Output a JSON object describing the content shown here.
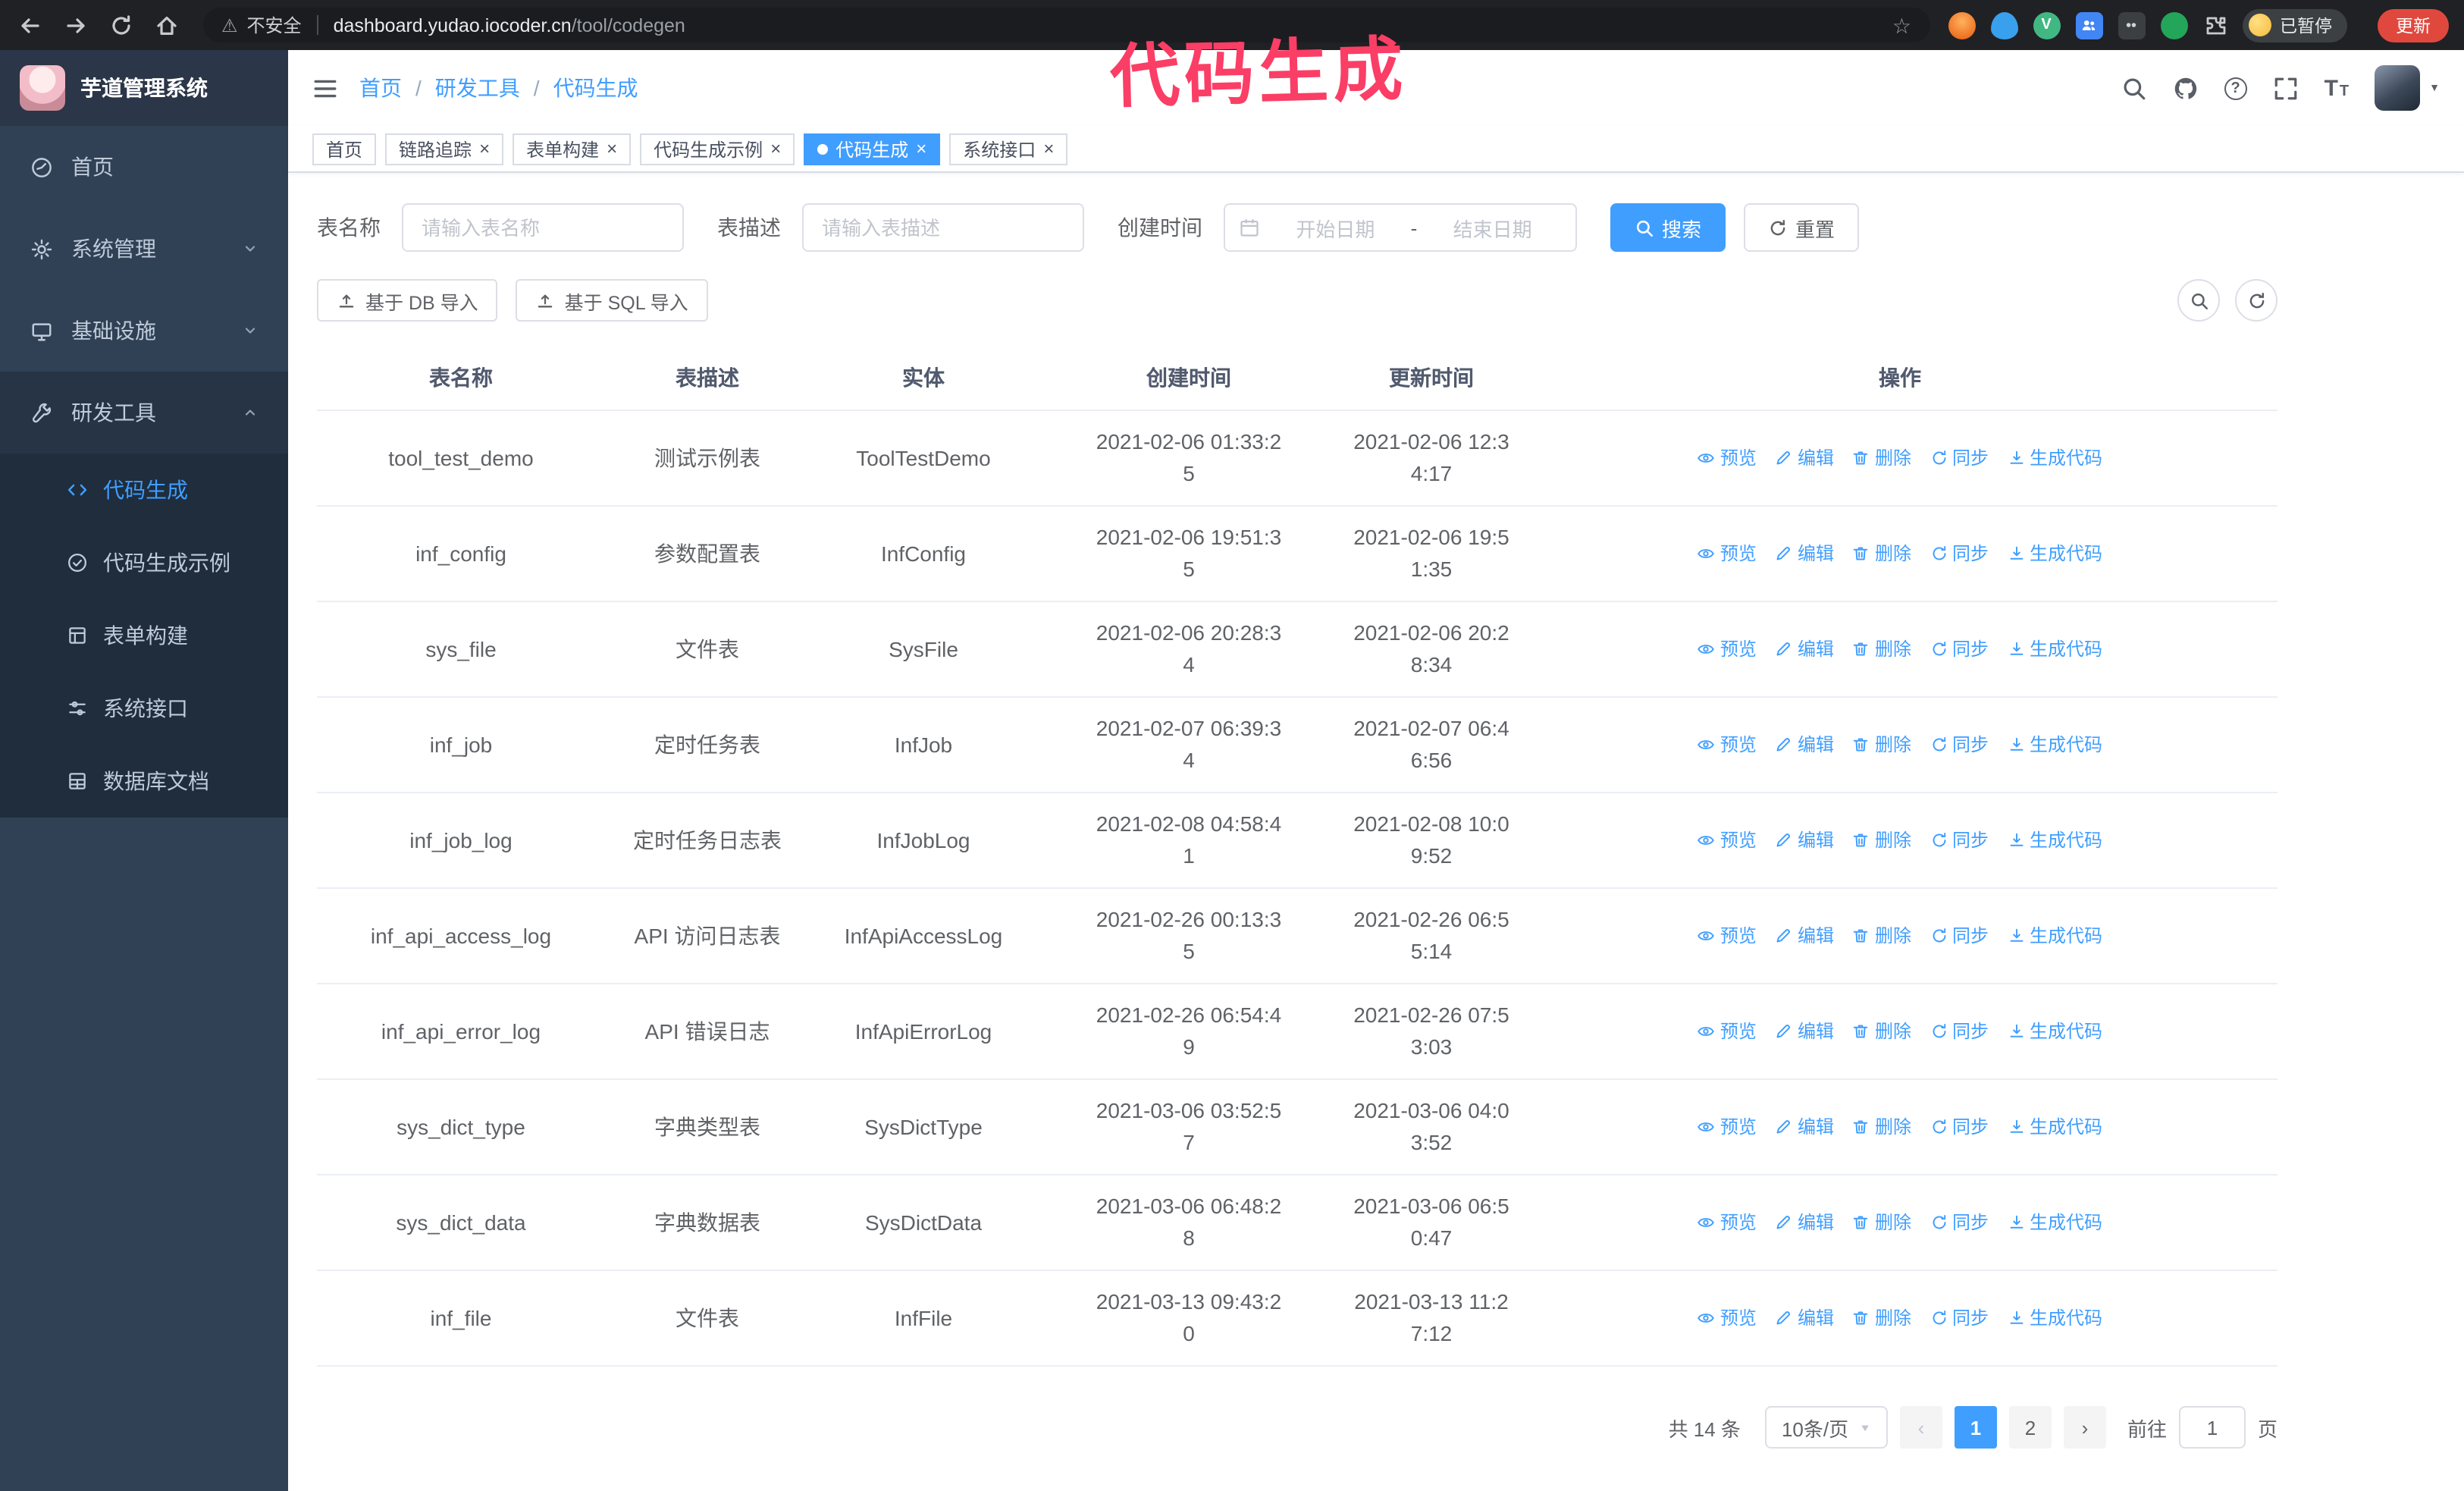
{
  "browser": {
    "security_label": "不安全",
    "url_host": "dashboard.yudao.iocoder.cn",
    "url_path": "/tool/codegen",
    "paused_badge": "已暂停",
    "update_button": "更新"
  },
  "annotation": {
    "text": "代码生成"
  },
  "colors": {
    "accent": "#409eff",
    "annotation": "#fb3e66",
    "sidebar_bg": "#304156",
    "submenu_bg": "#1f2d3d"
  },
  "icons": {
    "warning": "⚠",
    "star": "☆",
    "help": "?",
    "close": "×",
    "caret_down": "▼",
    "font_large": "T",
    "font_small": "T",
    "vue": "V"
  },
  "sidebar": {
    "logo_title": "芋道管理系统",
    "items": [
      {
        "label": "首页"
      },
      {
        "label": "系统管理"
      },
      {
        "label": "基础设施"
      },
      {
        "label": "研发工具"
      }
    ],
    "submenu": [
      {
        "label": "代码生成"
      },
      {
        "label": "代码生成示例"
      },
      {
        "label": "表单构建"
      },
      {
        "label": "系统接口"
      },
      {
        "label": "数据库文档"
      }
    ]
  },
  "header": {
    "breadcrumb": [
      "首页",
      "研发工具",
      "代码生成"
    ],
    "separator": "/"
  },
  "tabs": {
    "items": [
      "首页",
      "链路追踪",
      "表单构建",
      "代码生成示例",
      "代码生成",
      "系统接口"
    ]
  },
  "filters": {
    "table_name_label": "表名称",
    "table_name_placeholder": "请输入表名称",
    "table_desc_label": "表描述",
    "table_desc_placeholder": "请输入表描述",
    "create_time_label": "创建时间",
    "date_start_placeholder": "开始日期",
    "date_separator": "-",
    "date_end_placeholder": "结束日期",
    "search_button": "搜索",
    "reset_button": "重置"
  },
  "toolbar": {
    "import_db": "基于 DB 导入",
    "import_sql": "基于 SQL 导入"
  },
  "table": {
    "columns": [
      "表名称",
      "表描述",
      "实体",
      "创建时间",
      "更新时间",
      "操作"
    ],
    "actions": [
      "预览",
      "编辑",
      "删除",
      "同步",
      "生成代码"
    ],
    "rows": [
      {
        "name": "tool_test_demo",
        "desc": "测试示例表",
        "entity": "ToolTestDemo",
        "created": "2021-02-06 01:33:25",
        "updated": "2021-02-06 12:34:17"
      },
      {
        "name": "inf_config",
        "desc": "参数配置表",
        "entity": "InfConfig",
        "created": "2021-02-06 19:51:35",
        "updated": "2021-02-06 19:51:35"
      },
      {
        "name": "sys_file",
        "desc": "文件表",
        "entity": "SysFile",
        "created": "2021-02-06 20:28:34",
        "updated": "2021-02-06 20:28:34"
      },
      {
        "name": "inf_job",
        "desc": "定时任务表",
        "entity": "InfJob",
        "created": "2021-02-07 06:39:34",
        "updated": "2021-02-07 06:46:56"
      },
      {
        "name": "inf_job_log",
        "desc": "定时任务日志表",
        "entity": "InfJobLog",
        "created": "2021-02-08 04:58:41",
        "updated": "2021-02-08 10:09:52"
      },
      {
        "name": "inf_api_access_log",
        "desc": "API 访问日志表",
        "entity": "InfApiAccessLog",
        "created": "2021-02-26 00:13:35",
        "updated": "2021-02-26 06:55:14"
      },
      {
        "name": "inf_api_error_log",
        "desc": "API 错误日志",
        "entity": "InfApiErrorLog",
        "created": "2021-02-26 06:54:49",
        "updated": "2021-02-26 07:53:03"
      },
      {
        "name": "sys_dict_type",
        "desc": "字典类型表",
        "entity": "SysDictType",
        "created": "2021-03-06 03:52:57",
        "updated": "2021-03-06 04:03:52"
      },
      {
        "name": "sys_dict_data",
        "desc": "字典数据表",
        "entity": "SysDictData",
        "created": "2021-03-06 06:48:28",
        "updated": "2021-03-06 06:50:47"
      },
      {
        "name": "inf_file",
        "desc": "文件表",
        "entity": "InfFile",
        "created": "2021-03-13 09:43:20",
        "updated": "2021-03-13 11:27:12"
      }
    ]
  },
  "pagination": {
    "total_text": "共 14 条",
    "page_size_text": "10条/页",
    "prev_glyph": "‹",
    "next_glyph": "›",
    "pages": [
      "1",
      "2"
    ],
    "goto_label": "前往",
    "goto_value": "1",
    "goto_suffix": "页"
  }
}
